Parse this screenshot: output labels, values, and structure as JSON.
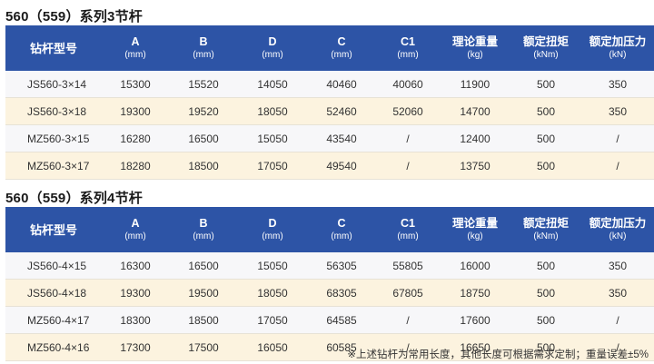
{
  "columns": [
    {
      "main": "钻杆型号",
      "unit": ""
    },
    {
      "main": "A",
      "unit": "(mm)"
    },
    {
      "main": "B",
      "unit": "(mm)"
    },
    {
      "main": "D",
      "unit": "(mm)"
    },
    {
      "main": "C",
      "unit": "(mm)"
    },
    {
      "main": "C1",
      "unit": "(mm)"
    },
    {
      "main": "理论重量",
      "unit": "(kg)"
    },
    {
      "main": "额定扭矩",
      "unit": "(kNm)"
    },
    {
      "main": "额定加压力",
      "unit": "(kN)"
    }
  ],
  "sections": [
    {
      "title": "560（559）系列3节杆",
      "rows": [
        [
          "JS560-3×14",
          "15300",
          "15520",
          "14050",
          "40460",
          "40060",
          "11900",
          "500",
          "350"
        ],
        [
          "JS560-3×18",
          "19300",
          "19520",
          "18050",
          "52460",
          "52060",
          "14700",
          "500",
          "350"
        ],
        [
          "MZ560-3×15",
          "16280",
          "16500",
          "15050",
          "43540",
          "/",
          "12400",
          "500",
          "/"
        ],
        [
          "MZ560-3×17",
          "18280",
          "18500",
          "17050",
          "49540",
          "/",
          "13750",
          "500",
          "/"
        ]
      ]
    },
    {
      "title": "560（559）系列4节杆",
      "rows": [
        [
          "JS560-4×15",
          "16300",
          "16500",
          "15050",
          "56305",
          "55805",
          "16000",
          "500",
          "350"
        ],
        [
          "JS560-4×18",
          "19300",
          "19500",
          "18050",
          "68305",
          "67805",
          "18750",
          "500",
          "350"
        ],
        [
          "MZ560-4×17",
          "18300",
          "18500",
          "17050",
          "64585",
          "/",
          "17600",
          "500",
          "/"
        ],
        [
          "MZ560-4×16",
          "17300",
          "17500",
          "16050",
          "60585",
          "/",
          "16650",
          "500",
          "/"
        ]
      ]
    }
  ],
  "footnote": "※上述钻杆为常用长度，其他长度可根据需求定制；重量误差±5%",
  "colors": {
    "header_bg": "#2d54a6",
    "row_light": "#f7f7f9",
    "row_cream": "#fcf3df"
  }
}
